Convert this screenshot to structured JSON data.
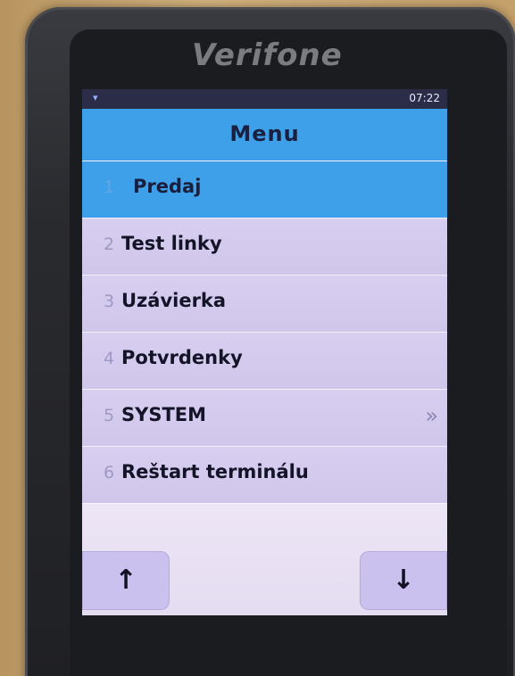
{
  "device": {
    "brand": "Verifone"
  },
  "status_bar": {
    "time": "07:22",
    "wifi_icon": "wifi-icon"
  },
  "screen": {
    "title": "Menu"
  },
  "menu": {
    "items": [
      {
        "number": "1",
        "label": "Predaj",
        "selected": true,
        "submenu": false
      },
      {
        "number": "2",
        "label": "Test linky",
        "selected": false,
        "submenu": false
      },
      {
        "number": "3",
        "label": "Uzávierka",
        "selected": false,
        "submenu": false
      },
      {
        "number": "4",
        "label": "Potvrdenky",
        "selected": false,
        "submenu": false
      },
      {
        "number": "5",
        "label": "SYSTEM",
        "selected": false,
        "submenu": true
      },
      {
        "number": "6",
        "label": "Reštart terminálu",
        "selected": false,
        "submenu": false
      }
    ],
    "submenu_glyph": "»"
  },
  "nav": {
    "up_glyph": "↑",
    "down_glyph": "↓"
  },
  "colors": {
    "header": "#3ea0e8",
    "selected": "#3ea0e8",
    "item_background": "#d4cbee",
    "status_bar": "#2b2d48"
  }
}
